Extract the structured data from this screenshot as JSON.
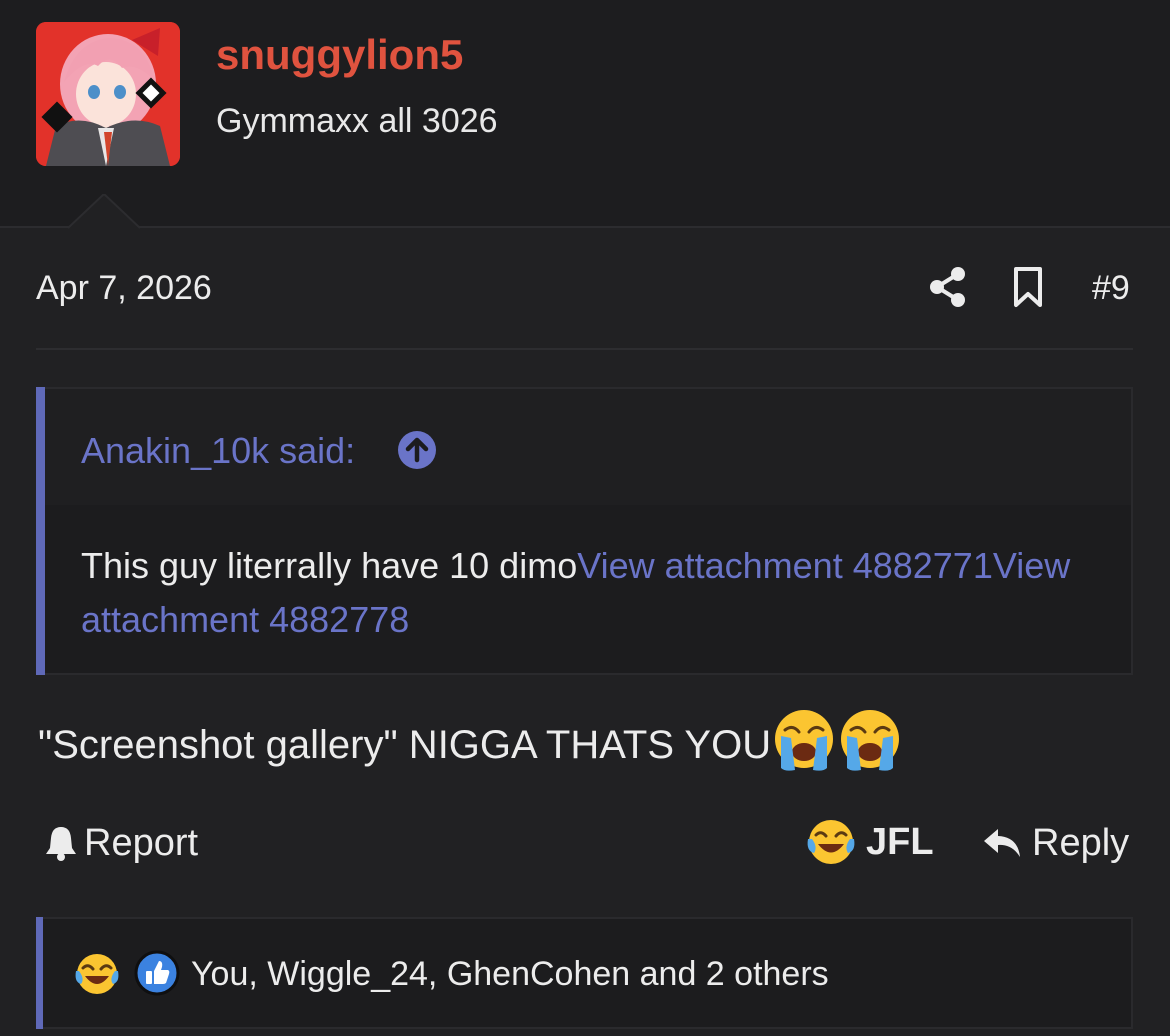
{
  "user": {
    "name": "snuggylion5",
    "title": "Gymmaxx all 3026",
    "name_color": "#e0533f"
  },
  "post": {
    "date": "Apr 7, 2026",
    "number": "#9",
    "share_icon": "share-icon",
    "bookmark_icon": "bookmark-icon"
  },
  "quote": {
    "author": "Anakin_10k said:",
    "text": "This guy literrally have 10 dimo",
    "attachments": [
      "View attachment 4882771",
      "View attachment 4882778"
    ],
    "accent_color": "#5f69b8",
    "link_color": "#6a74c8"
  },
  "message": {
    "text": "\"Screenshot gallery\" NIGGA THATS YOU",
    "emojis": [
      "loudly-crying-face",
      "loudly-crying-face"
    ]
  },
  "actions": {
    "report_label": "Report",
    "reaction_label": "JFL",
    "reply_label": "Reply"
  },
  "reactions": {
    "icons": [
      "tears-of-joy-face",
      "thumbs-up"
    ],
    "summary": "You, Wiggle_24, GhenCohen and 2 others"
  }
}
